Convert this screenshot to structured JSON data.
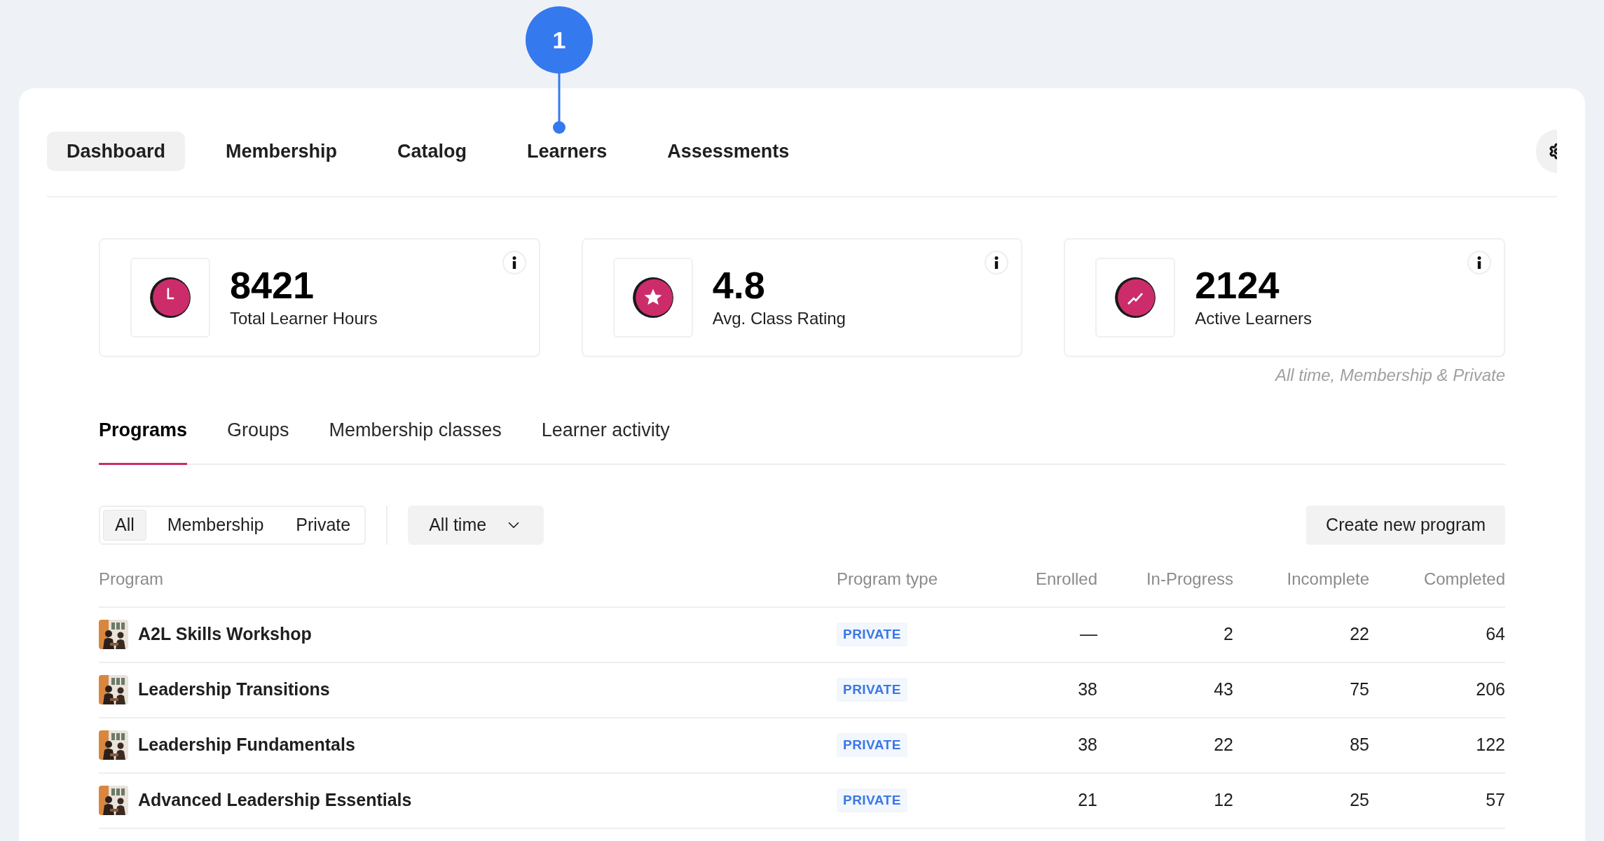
{
  "callout": {
    "label": "1"
  },
  "nav": [
    {
      "label": "Dashboard",
      "selected": true
    },
    {
      "label": "Membership",
      "selected": false
    },
    {
      "label": "Catalog",
      "selected": false
    },
    {
      "label": "Learners",
      "selected": false
    },
    {
      "label": "Assessments",
      "selected": false
    }
  ],
  "stats": [
    {
      "kind": "clock",
      "value": "8421",
      "label": "Total Learner Hours"
    },
    {
      "kind": "star",
      "value": "4.8",
      "label": "Avg. Class Rating"
    },
    {
      "kind": "trend",
      "value": "2124",
      "label": "Active Learners"
    }
  ],
  "stats_note": "All time, Membership & Private",
  "tabs": [
    {
      "label": "Programs",
      "selected": true
    },
    {
      "label": "Groups",
      "selected": false
    },
    {
      "label": "Membership classes",
      "selected": false
    },
    {
      "label": "Learner activity",
      "selected": false
    }
  ],
  "type_filter": [
    {
      "label": "All",
      "selected": true
    },
    {
      "label": "Membership",
      "selected": false
    },
    {
      "label": "Private",
      "selected": false
    }
  ],
  "period": {
    "value": "All time"
  },
  "create_button": "Create new program",
  "table": {
    "columns": [
      "Program",
      "Program type",
      "Enrolled",
      "In-Progress",
      "Incomplete",
      "Completed"
    ],
    "rows": [
      {
        "name": "A2L Skills Workshop",
        "type": "PRIVATE",
        "enrolled": "—",
        "in_progress": "2",
        "incomplete": "22",
        "completed": "64"
      },
      {
        "name": "Leadership Transitions",
        "type": "PRIVATE",
        "enrolled": "38",
        "in_progress": "43",
        "incomplete": "75",
        "completed": "206"
      },
      {
        "name": "Leadership Fundamentals",
        "type": "PRIVATE",
        "enrolled": "38",
        "in_progress": "22",
        "incomplete": "85",
        "completed": "122"
      },
      {
        "name": "Advanced Leadership Essentials",
        "type": "PRIVATE",
        "enrolled": "21",
        "in_progress": "12",
        "incomplete": "25",
        "completed": "57"
      }
    ]
  }
}
